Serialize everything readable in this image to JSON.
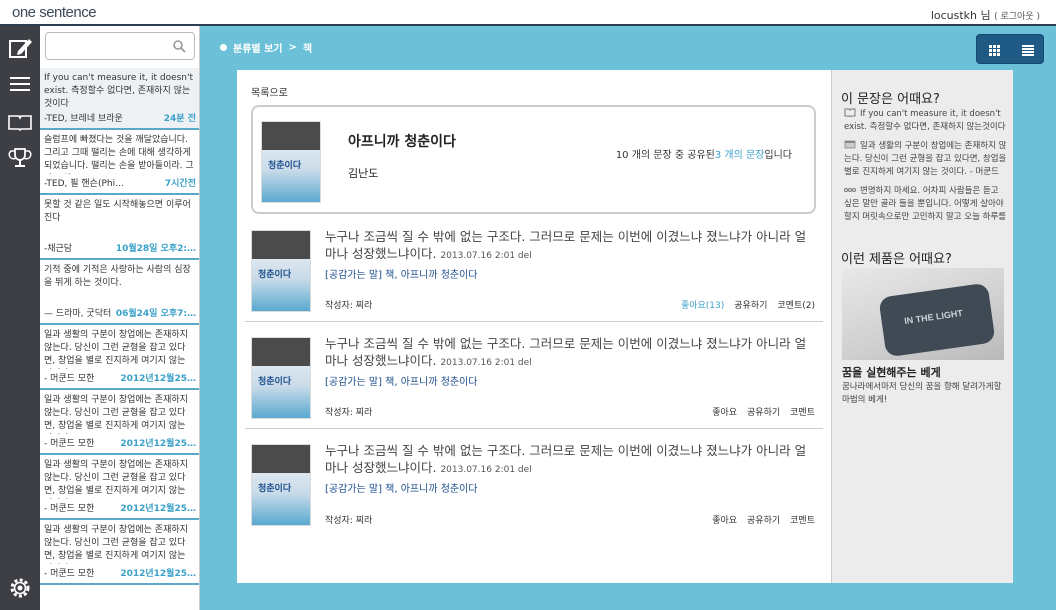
{
  "header": {
    "logo": "one sentence",
    "user": "locustkh 님",
    "logout": "( 로그아웃 )"
  },
  "rail": {
    "items": [
      "write-icon",
      "menu-icon",
      "book-icon",
      "trophy-icon",
      "gear-icon"
    ]
  },
  "search": {
    "placeholder": "",
    "value": ""
  },
  "feed": [
    {
      "text": "If you can't measure it, it doesn't exist. 측정할수 없다면, 존재하지 않는것이다",
      "author": "-TED, 브레네 브라운",
      "time": "24분 전"
    },
    {
      "text": "슬럼프에 빠졌다는 것을 깨달았습니다. 그리고 그때 떨리는 손에 대해 생각하게 되었습니다. 떨리는 손을 받아들이라. 그리고 장",
      "author": "-TED, 필 핸슨(Phi…",
      "time": "7시간전"
    },
    {
      "text": "못할 것 같은 일도 시작해놓으면 이루어진다",
      "author": "-채근담",
      "time": "10월28일 오후2:…"
    },
    {
      "text": "기적 중에 기적은 사랑하는 사람의 심장을 뛰게 하는 것이다.",
      "author": "— 드라마, 굿닥터",
      "time": "06월24일 오후7:…"
    },
    {
      "text": "일과 생활의 구분이 창업에는 존재하지 않는다. 당신이 그런 균형을 잡고 있다면, 창업을 별로 진지하게 여기지 않는 것이다.",
      "author": "- 머쿤드 모한",
      "time": "2012년12월25…"
    },
    {
      "text": "일과 생활의 구분이 창업에는 존재하지 않는다. 당신이 그런 균형을 잡고 있다면, 창업을 별로 진지하게 여기지 않는 것이다.",
      "author": "- 머쿤드 모한",
      "time": "2012년12월25…"
    },
    {
      "text": "일과 생활의 구분이 창업에는 존재하지 않는다. 당신이 그런 균형을 잡고 있다면, 창업을 별로 진지하게 여기지 않는 것이다.",
      "author": "- 머쿤드 모한",
      "time": "2012년12월25…"
    },
    {
      "text": "일과 생활의 구분이 창업에는 존재하지 않는다. 당신이 그런 균형을 잡고 있다면, 창업을 별로 진지하게 여기지 않는 것이다.",
      "author": "- 머쿤드 모한",
      "time": "2012년12월25…"
    }
  ],
  "breadcrumb": {
    "first": "분류별 보기",
    "separator": ">",
    "second": "책"
  },
  "back_link": "목록으로",
  "book": {
    "title": "아프니까 청춘이다",
    "author": "김난도",
    "cover_title": "청춘이다",
    "stats_pre": "10 개의 문장 중 공유된",
    "stats_hl": "3 개의 문장",
    "stats_post": "입니다"
  },
  "posts": [
    {
      "text": "누구나 조금씩 질 수 밖에 없는 구조다. 그러므로 문제는 이번에 이겼느냐 졌느냐가 아니라 얼마나 성장했느냐이다.",
      "date": "2013.07.16 2:01 del",
      "tag": "[공감가는 말] 책, 아프니까 청춘이다",
      "author": "작성자: 찌라",
      "like": "좋아요(13)",
      "share": "공유하기",
      "comment": "코멘트(2)"
    },
    {
      "text": "누구나 조금씩 질 수 밖에 없는 구조다. 그러므로 문제는 이번에 이겼느냐 졌느냐가 아니라 얼마나 성장했느냐이다.",
      "date": "2013.07.16 2:01 del",
      "tag": "[공감가는 말] 책, 아프니까 청춘이다",
      "author": "작성자: 찌라",
      "like": "좋아요",
      "share": "공유하기",
      "comment": "코멘트"
    },
    {
      "text": "누구나 조금씩 질 수 밖에 없는 구조다. 그러므로 문제는 이번에 이겼느냐 졌느냐가 아니라 얼마나 성장했느냐이다.",
      "date": "2013.07.16 2:01 del",
      "tag": "[공감가는 말] 책, 아프니까 청춘이다",
      "author": "작성자: 찌라",
      "like": "좋아요",
      "share": "공유하기",
      "comment": "코멘트"
    }
  ],
  "side": {
    "heading1": "이 문장은 어때요?",
    "quotes": [
      "If you can't measure it, it doesn't exist. 측정할수 없다면, 존재하지 않는것이다",
      "일과 생활의 구분이 창업에는 존재하지 않는다. 당신이 그런 균형을 잡고 있다면, 창업을 별로 진지하게 여기지 않는 것이다. - 머쿤드",
      "변명하지 마세요. 어차피 사람들은 듣고 싶은 말만 골라 들을 뿐입니다. 어떻게 살아야 할지 머릿속으로만 고민하지 말고 오늘 하루를"
    ],
    "heading2": "이런 제품은 어때요?",
    "product_image_text": "IN THE LIGHT",
    "product_name": "꿈을 실현해주는 베게",
    "product_desc": "꿈나라에서마저 당신의 꿈을 향해 달려가게할 마법의 베게!"
  },
  "colors": {
    "accent": "#3aa0c9",
    "main_bg": "#6cc1d8",
    "rail": "#3d3f44",
    "toggle": "#1f5a84"
  }
}
